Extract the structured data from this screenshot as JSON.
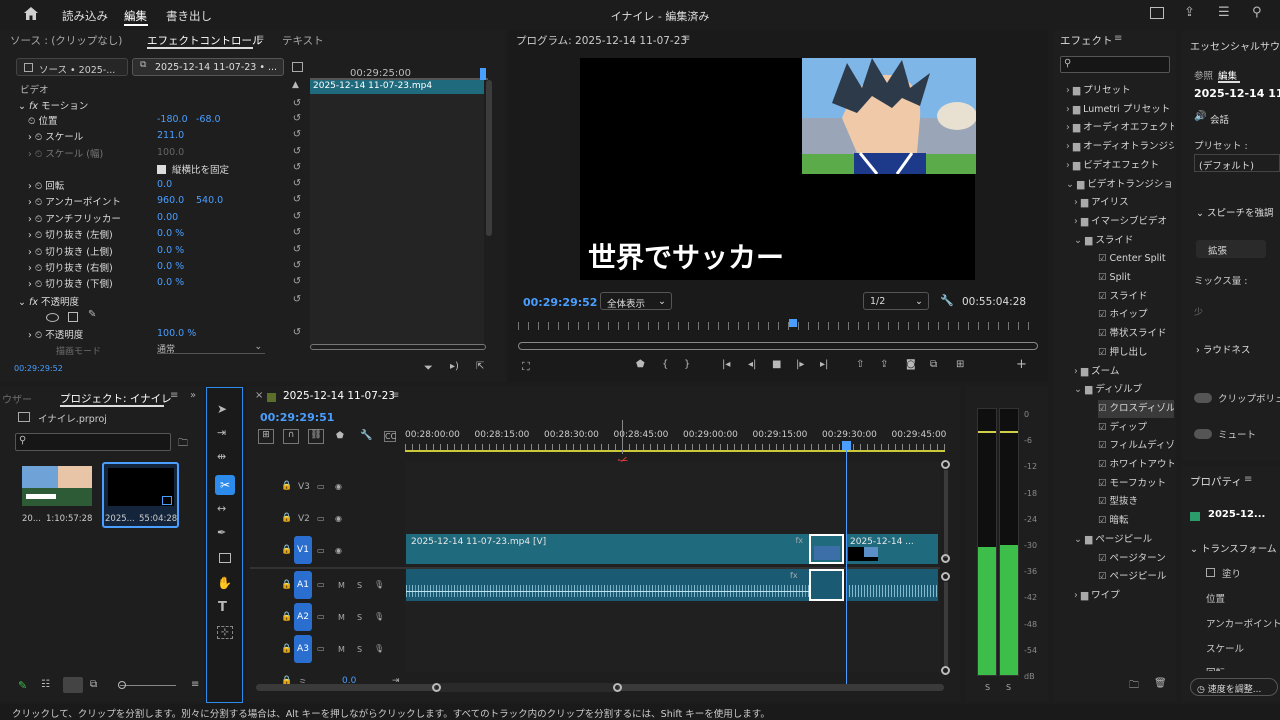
{
  "menu": {
    "items": [
      "読み込み",
      "編集",
      "書き出し"
    ],
    "title": "イナイレ - 編集済み"
  },
  "source_panel": {
    "tabs": [
      "ソース : (クリップなし)",
      "エフェクトコントロール",
      "テキスト"
    ],
    "source_sel": "ソース • 2025-...",
    "clip_sel": "2025-12-14 11-07-23 • ...",
    "timecode_ruler": "00:29:25:00",
    "clip_bar": "2025-12-14 11-07-23.mp4",
    "video_label": "ビデオ",
    "motion": "モーション",
    "props": [
      {
        "name": "位置",
        "v1": "-180.0",
        "v2": "-68.0"
      },
      {
        "name": "スケール",
        "v1": "211.0",
        "v2": ""
      },
      {
        "name": "スケール (幅)",
        "v1": "100.0",
        "v2": ""
      },
      {
        "name": "縦横比を固定",
        "v1": "",
        "v2": ""
      },
      {
        "name": "回転",
        "v1": "0.0",
        "v2": ""
      },
      {
        "name": "アンカーポイント",
        "v1": "960.0",
        "v2": "540.0"
      },
      {
        "name": "アンチフリッカー",
        "v1": "0.00",
        "v2": ""
      },
      {
        "name": "切り抜き (左側)",
        "v1": "0.0 %",
        "v2": ""
      },
      {
        "name": "切り抜き (上側)",
        "v1": "0.0 %",
        "v2": ""
      },
      {
        "name": "切り抜き (右側)",
        "v1": "0.0 %",
        "v2": ""
      },
      {
        "name": "切り抜き (下側)",
        "v1": "0.0 %",
        "v2": ""
      }
    ],
    "opacity_label": "不透明度",
    "opacity_prop": "不透明度",
    "opacity_value": "100.0 %",
    "blend_label": "描画モード",
    "blend_value": "通常",
    "footer_time": "00:29:29:52"
  },
  "program": {
    "title": "プログラム: 2025-12-14 11-07-23",
    "overlay_text": "世界でサッカー",
    "timecode": "00:29:29:52",
    "zoom": "全体表示",
    "resolution": "1/2",
    "duration": "00:55:04:28"
  },
  "project": {
    "tab_prev": "ウザー",
    "tab": "プロジェクト: イナイレ",
    "file": "イナイレ.prproj",
    "items": [
      {
        "name": "20...",
        "dur": "1:10:57:28"
      },
      {
        "name": "2025...",
        "dur": "55:04:28"
      }
    ]
  },
  "timeline": {
    "tab": "2025-12-14 11-07-23",
    "timecode": "00:29:29:51",
    "ruler": [
      "00:28:00:00",
      "00:28:15:00",
      "00:28:30:00",
      "00:28:45:00",
      "00:29:00:00",
      "00:29:15:00",
      "00:29:30:00",
      "00:29:45:00"
    ],
    "tracks": [
      "V3",
      "V2",
      "V1",
      "A1",
      "A2",
      "A3"
    ],
    "clip_main": "2025-12-14 11-07-23.mp4 [V]",
    "clip_right": "2025-12-14 ...",
    "mix_value": "0.0",
    "mix_label": "ミ..."
  },
  "meter": {
    "ticks": [
      "0",
      "-6",
      "-12",
      "-18",
      "-24",
      "-30",
      "-36",
      "-42",
      "-48",
      "-54",
      "dB"
    ],
    "solo": [
      "S",
      "S"
    ]
  },
  "effects": {
    "title": "エフェクト",
    "items": [
      {
        "label": "プリセット",
        "level": 0,
        "type": "folder"
      },
      {
        "label": "Lumetri プリセット",
        "level": 0,
        "type": "folder"
      },
      {
        "label": "オーディオエフェクト",
        "level": 0,
        "type": "folder"
      },
      {
        "label": "オーディオトランジション",
        "level": 0,
        "type": "folder"
      },
      {
        "label": "ビデオエフェクト",
        "level": 0,
        "type": "folder"
      },
      {
        "label": "ビデオトランジション",
        "level": 0,
        "type": "folder-open"
      },
      {
        "label": "アイリス",
        "level": 1,
        "type": "folder"
      },
      {
        "label": "イマーシブビデオ",
        "level": 1,
        "type": "folder"
      },
      {
        "label": "スライド",
        "level": 1,
        "type": "folder-open"
      },
      {
        "label": "Center Split",
        "level": 2,
        "type": "fx"
      },
      {
        "label": "Split",
        "level": 2,
        "type": "fx"
      },
      {
        "label": "スライド",
        "level": 2,
        "type": "fx"
      },
      {
        "label": "ホイップ",
        "level": 2,
        "type": "fx"
      },
      {
        "label": "帯状スライド",
        "level": 2,
        "type": "fx"
      },
      {
        "label": "押し出し",
        "level": 2,
        "type": "fx"
      },
      {
        "label": "ズーム",
        "level": 1,
        "type": "folder"
      },
      {
        "label": "ディゾルブ",
        "level": 1,
        "type": "folder-open"
      },
      {
        "label": "クロスディゾルブ",
        "level": 2,
        "type": "fx"
      },
      {
        "label": "ディップ",
        "level": 2,
        "type": "fx"
      },
      {
        "label": "フィルムディゾルブ",
        "level": 2,
        "type": "fx"
      },
      {
        "label": "ホワイトアウト",
        "level": 2,
        "type": "fx"
      },
      {
        "label": "モーフカット",
        "level": 2,
        "type": "fx"
      },
      {
        "label": "型抜き",
        "level": 2,
        "type": "fx"
      },
      {
        "label": "暗転",
        "level": 2,
        "type": "fx"
      },
      {
        "label": "ページピール",
        "level": 1,
        "type": "folder-open"
      },
      {
        "label": "ページターン",
        "level": 2,
        "type": "fx"
      },
      {
        "label": "ページピール",
        "level": 2,
        "type": "fx"
      },
      {
        "label": "ワイプ",
        "level": 1,
        "type": "folder"
      }
    ]
  },
  "essential": {
    "title": "エッセンシャルサウンド",
    "tabs": [
      "参照",
      "編集"
    ],
    "clip": "2025-12-14 11",
    "type": "会話",
    "preset_label": "プリセット :",
    "preset_value": "(デフォルト)",
    "section1": "スピーチを強調",
    "enhance_btn": "拡張",
    "mix_label": "ミックス量 :",
    "mix_hint": "少",
    "section2": "ラウドネス",
    "toggle1": "クリップボリューム",
    "toggle2": "ミュート"
  },
  "properties": {
    "title": "プロパティ",
    "clip": "2025-12...",
    "section": "トランスフォーム",
    "fill": "塗り",
    "rows": [
      "位置",
      "アンカーポイント",
      "スケール",
      "回転"
    ],
    "speed_btn": "速度を調整..."
  },
  "status_bar": "クリックして、クリップを分割します。別々に分割する場合は、Alt キーを押しながらクリックします。すべてのトラック内のクリップを分割するには、Shift キーを使用します。",
  "colors": {
    "accent": "#2d8ceb",
    "clip_video": "#1f6a7d",
    "clip_audio": "#1a5b73",
    "playhead": "#4a9eff",
    "meter_green": "#3dbd4a"
  }
}
